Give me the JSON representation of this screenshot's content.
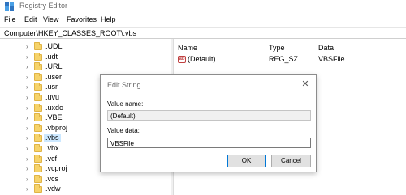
{
  "window": {
    "title": "Registry Editor",
    "icon": "registry-editor-icon"
  },
  "menu": [
    "File",
    "Edit",
    "View",
    "Favorites",
    "Help"
  ],
  "address": "Computer\\HKEY_CLASSES_ROOT\\.vbs",
  "tree": {
    "items": [
      {
        "label": ".UDL",
        "selected": false
      },
      {
        "label": ".udt",
        "selected": false
      },
      {
        "label": ".URL",
        "selected": false
      },
      {
        "label": ".user",
        "selected": false
      },
      {
        "label": ".usr",
        "selected": false
      },
      {
        "label": ".uvu",
        "selected": false
      },
      {
        "label": ".uxdc",
        "selected": false
      },
      {
        "label": ".VBE",
        "selected": false
      },
      {
        "label": ".vbproj",
        "selected": false
      },
      {
        "label": ".vbs",
        "selected": true
      },
      {
        "label": ".vbx",
        "selected": false
      },
      {
        "label": ".vcf",
        "selected": false
      },
      {
        "label": ".vcproj",
        "selected": false
      },
      {
        "label": ".vcs",
        "selected": false
      },
      {
        "label": ".vdw",
        "selected": false
      }
    ]
  },
  "values": {
    "headers": {
      "name": "Name",
      "type": "Type",
      "data": "Data"
    },
    "rows": [
      {
        "name": "(Default)",
        "type": "REG_SZ",
        "data": "VBSFile",
        "icon": "string-value-icon"
      }
    ]
  },
  "dialog": {
    "title": "Edit String",
    "value_name_label": "Value name:",
    "value_name": "(Default)",
    "value_data_label": "Value data:",
    "value_data": "VBSFile",
    "ok_label": "OK",
    "cancel_label": "Cancel",
    "close_glyph": "✕"
  },
  "colors": {
    "selection": "#cce8ff",
    "folder": "#f6d36a",
    "accent": "#0078d7"
  }
}
